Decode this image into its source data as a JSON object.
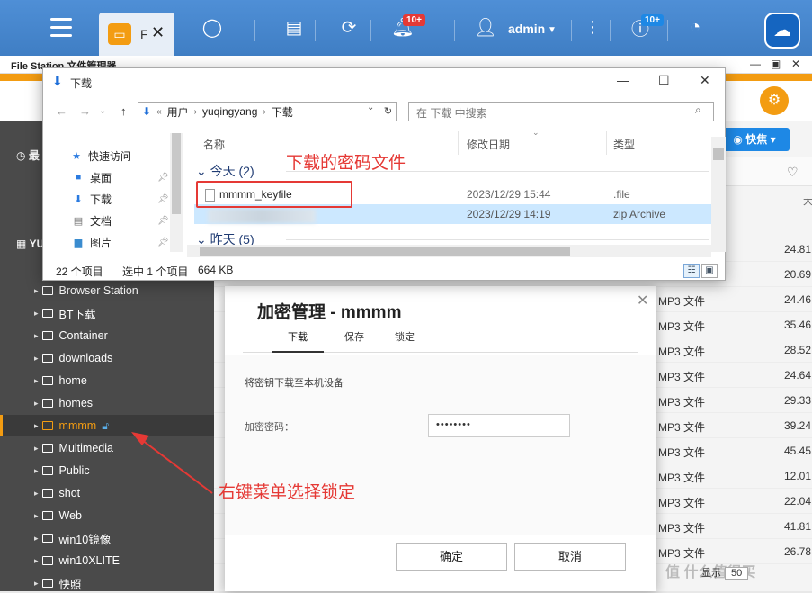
{
  "topbar": {
    "tab_label": "F",
    "user": "admin",
    "notif_badge": "10+",
    "update_badge": "10+"
  },
  "file_station": {
    "title": "File Station 文件管理器",
    "quick_button": "快焦",
    "sidebar": {
      "header1": "最",
      "header2": "YU",
      "items": [
        "Browser Station",
        "BT下载",
        "Container",
        "downloads",
        "home",
        "homes",
        "mmmm",
        "Multimedia",
        "Public",
        "shot",
        "Web",
        "win10镜像",
        "win10XLITE",
        "快照"
      ]
    },
    "list_rows": [
      {
        "type": "",
        "size": "24.81"
      },
      {
        "type": "",
        "size": "20.69"
      },
      {
        "type": "MP3 文件",
        "size": "24.46"
      },
      {
        "type": "MP3 文件",
        "size": "35.46"
      },
      {
        "type": "MP3 文件",
        "size": "28.52"
      },
      {
        "type": "MP3 文件",
        "size": "24.64"
      },
      {
        "type": "MP3 文件",
        "size": "29.33"
      },
      {
        "type": "MP3 文件",
        "size": "39.24"
      },
      {
        "type": "MP3 文件",
        "size": "45.45"
      },
      {
        "type": "MP3 文件",
        "size": "12.01"
      },
      {
        "type": "MP3 文件",
        "size": "22.04"
      },
      {
        "type": "MP3 文件",
        "size": "41.81"
      },
      {
        "type": "MP3 文件",
        "size": "26.78"
      }
    ],
    "col_partial": "大",
    "pager_label": "显示",
    "pager_value": "50"
  },
  "enc_dialog": {
    "title": "加密管理 - mmmm",
    "tabs": [
      "下载",
      "保存",
      "锁定"
    ],
    "description": "将密钥下载至本机设备",
    "password_label": "加密密码：",
    "password_value": "••••••••",
    "ok": "确定",
    "cancel": "取消"
  },
  "win_dialog": {
    "title": "下载",
    "path": [
      "用户",
      "yuqingyang",
      "下载"
    ],
    "search_placeholder": "在 下载 中搜索",
    "nav": [
      "快速访问",
      "桌面",
      "下载",
      "文档",
      "图片"
    ],
    "columns": [
      "名称",
      "修改日期",
      "类型"
    ],
    "group_today": "今天 (2)",
    "group_yesterday": "昨天 (5)",
    "files": [
      {
        "name": "mmmm_keyfile",
        "date": "2023/12/29 15:44",
        "type": ".file"
      },
      {
        "name": "",
        "date": "2023/12/29 14:19",
        "type": "zip Archive"
      }
    ],
    "status_count": "22 个项目",
    "status_selected": "选中 1 个项目",
    "status_size": "664 KB"
  },
  "annotations": {
    "keyfile_note": "下载的密码文件",
    "menu_note": "右键菜单选择锁定"
  },
  "watermark": "值 什么值得买",
  "colors": {
    "accent": "#f39c12",
    "brand_blue": "#1e88e5",
    "annotation": "#e53935"
  }
}
